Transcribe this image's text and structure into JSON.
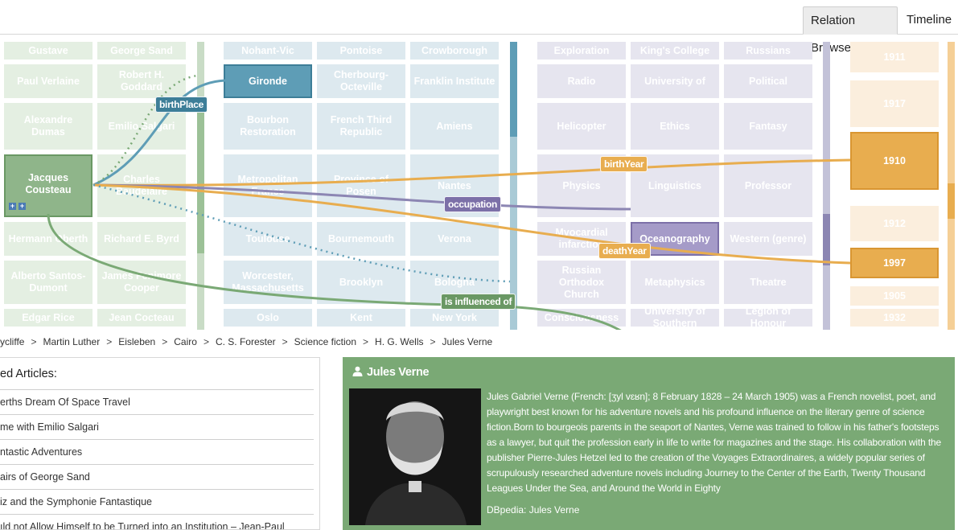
{
  "tabs": [
    "Relation Browser",
    "Timeline"
  ],
  "columns": {
    "persons": [
      [
        "Gustave",
        "George Sand"
      ],
      [
        "Paul Verlaine",
        "Robert H. Goddard"
      ],
      [
        "Alexandre Dumas",
        "Emilio Salgari"
      ],
      [
        "Jacques Cousteau",
        "Charles Baudelaire"
      ],
      [
        "Hermann Oberth",
        "Richard E. Byrd"
      ],
      [
        "Alberto Santos-Dumont",
        "James Fenimore Cooper"
      ],
      [
        "Edgar Rice",
        "Jean Cocteau"
      ]
    ],
    "places": [
      [
        "Nohant-Vic",
        "Pontoise",
        "Crowborough"
      ],
      [
        "Gironde",
        "Cherbourg-Octeville",
        "Franklin Institute"
      ],
      [
        "Bourbon Restoration",
        "French Third Republic",
        "Amiens"
      ],
      [
        "Metropolitan France",
        "Province of Posen",
        "Nantes"
      ],
      [
        "Toulouse",
        "Bournemouth",
        "Verona"
      ],
      [
        "Worcester, Massachusetts",
        "Brooklyn",
        "Bologna"
      ],
      [
        "Oslo",
        "Kent",
        "New York"
      ]
    ],
    "concepts": [
      [
        "Exploration",
        "King's College",
        "Russians"
      ],
      [
        "Radio",
        "University of",
        "Political"
      ],
      [
        "Helicopter",
        "Ethics",
        "Fantasy"
      ],
      [
        "Physics",
        "Linguistics",
        "Professor"
      ],
      [
        "Myocardial infarction",
        "Oceanography",
        "Western (genre)"
      ],
      [
        "Russian Orthodox Church",
        "Metaphysics",
        "Theatre"
      ],
      [
        "Consciousness",
        "University of Southern",
        "Legion of Honour"
      ]
    ],
    "years": [
      "1911",
      "1917",
      "1910",
      "1912",
      "1997",
      "1905",
      "1932"
    ]
  },
  "edge_labels": {
    "birth_place": "birthPlace",
    "birth_year": "birthYear",
    "occupation": "occupation",
    "death_year": "deathYear",
    "influenced": "is influenced of"
  },
  "breadcrumb": [
    "ycliffe",
    "Martin Luther",
    "Eisleben",
    "Cairo",
    "C. S. Forester",
    "Science fiction",
    "H. G. Wells",
    "Jules Verne"
  ],
  "breadcrumb_sep": ">",
  "related": {
    "title": "ed Articles:",
    "items": [
      "erths Dream Of Space Travel",
      "me with Emilio Salgari",
      "ntastic Adventures",
      "airs of George Sand",
      "iz and the Symphonie Fantastique",
      "ıld not Allow Himself to be Turned into an Institution – Jean-Paul"
    ]
  },
  "info": {
    "title": "Jules Verne",
    "icon": "person-icon",
    "body": "Jules Gabriel Verne (French: [ʒyl vɛʁn]; 8 February 1828 – 24 March 1905) was a French novelist, poet, and playwright best known for his adventure novels and his profound influence on the literary genre of science fiction.Born to bourgeois parents in the seaport of Nantes, Verne was trained to follow in his father's footsteps as a lawyer, but quit the profession early in life to write for magazines and the stage. His collaboration with the publisher Pierre-Jules Hetzel led to the creation of the Voyages Extraordinaires, a widely popular series of scrupulously researched adventure novels including Journey to the Center of the Earth, Twenty Thousand Leagues Under the Sea, and Around the World in Eighty",
    "source": "DBpedia: Jules Verne"
  },
  "colors": {
    "green": "#7aa975",
    "blue": "#5e9db6",
    "purple": "#8c86b3",
    "orange": "#e8ad4f"
  }
}
